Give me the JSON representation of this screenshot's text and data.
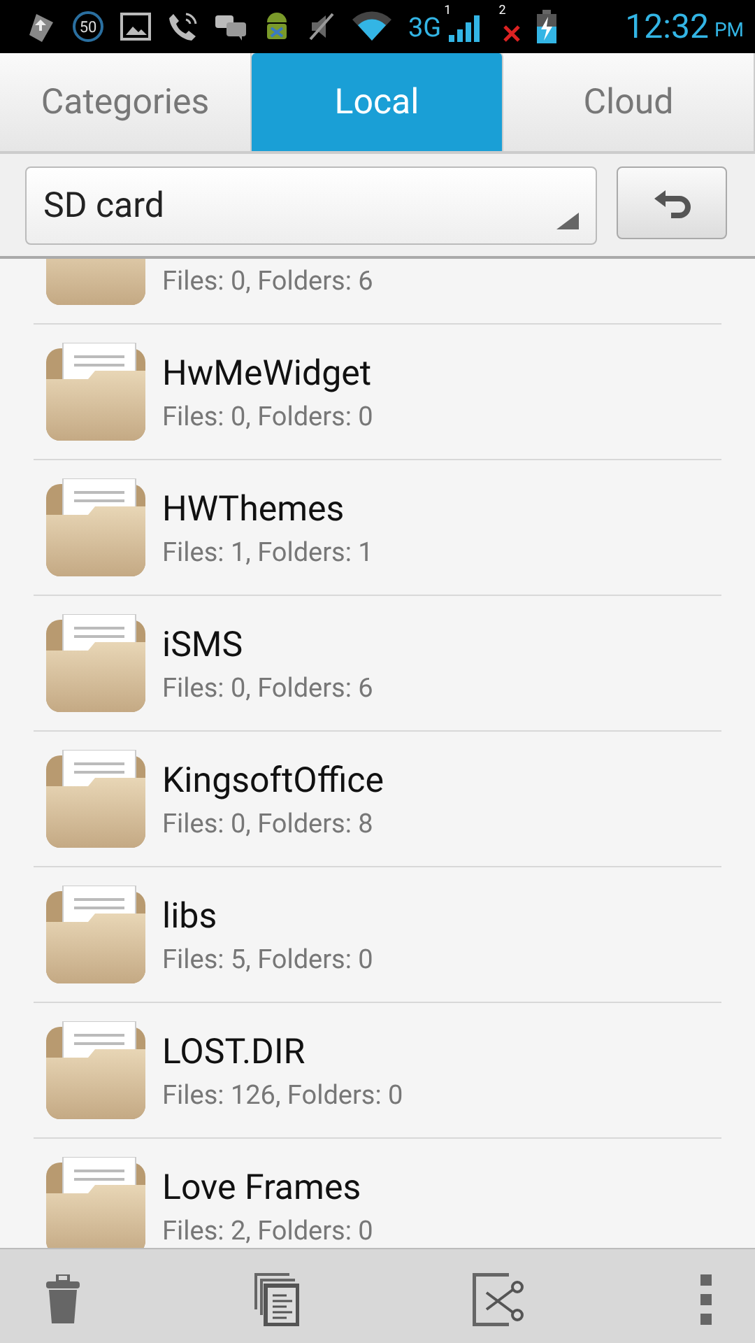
{
  "status_bar": {
    "badge": "50",
    "network": "3G",
    "sim1": "1",
    "sim2": "2",
    "time": "12:32",
    "ampm": "PM"
  },
  "tabs": [
    {
      "label": "Categories",
      "selected": false
    },
    {
      "label": "Local",
      "selected": true
    },
    {
      "label": "Cloud",
      "selected": false
    }
  ],
  "location": {
    "value": "SD card"
  },
  "folders": [
    {
      "subtitle": "Files: 0, Folders: 6"
    },
    {
      "name": "HwMeWidget",
      "subtitle": "Files: 0, Folders: 0"
    },
    {
      "name": "HWThemes",
      "subtitle": "Files: 1, Folders: 1"
    },
    {
      "name": "iSMS",
      "subtitle": "Files: 0, Folders: 6"
    },
    {
      "name": "KingsoftOffice",
      "subtitle": "Files: 0, Folders: 8"
    },
    {
      "name": "libs",
      "subtitle": "Files: 5, Folders: 0"
    },
    {
      "name": "LOST.DIR",
      "subtitle": "Files: 126, Folders: 0"
    },
    {
      "name": "Love Frames",
      "subtitle": "Files: 2, Folders: 0"
    }
  ]
}
